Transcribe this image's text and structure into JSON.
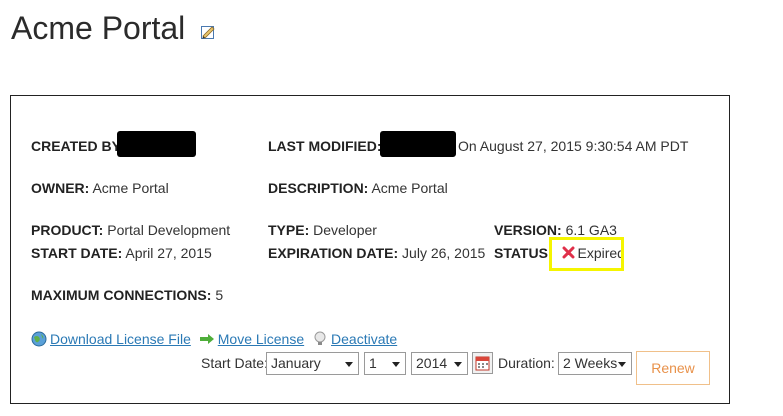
{
  "page": {
    "title": "Acme Portal"
  },
  "details": {
    "created_by_label": "CREATED BY:",
    "last_modified_label": "LAST MODIFIED:",
    "last_modified_value": "On August 27, 2015 9:30:54 AM PDT",
    "owner_label": "OWNER:",
    "owner_value": "Acme Portal",
    "description_label": "DESCRIPTION:",
    "description_value": "Acme Portal",
    "product_label": "PRODUCT:",
    "product_value": "Portal Development",
    "type_label": "TYPE:",
    "type_value": "Developer",
    "version_label": "VERSION:",
    "version_value": "6.1 GA3",
    "start_date_label": "START DATE:",
    "start_date_value": "April 27, 2015",
    "expiration_date_label": "EXPIRATION DATE:",
    "expiration_date_value": "July 26, 2015",
    "status_label": "STATUS:",
    "status_value": "Expired",
    "max_connections_label": "MAXIMUM CONNECTIONS:",
    "max_connections_value": "5"
  },
  "actions": {
    "download": "Download License File",
    "move": "Move License",
    "deactivate": "Deactivate"
  },
  "renew_form": {
    "start_date_label": "Start Date:",
    "month": "January",
    "day": "1",
    "year": "2014",
    "duration_label": "Duration:",
    "duration": "2 Weeks",
    "renew_button": "Renew"
  },
  "icons": {
    "edit": "edit-icon",
    "status": "x-icon",
    "download": "globe-icon",
    "move": "arrow-right-icon",
    "deactivate": "lightbulb-icon",
    "calendar": "calendar-icon"
  },
  "colors": {
    "link": "#2a79b5",
    "renew_text": "#e8914a",
    "highlight": "#f5f500",
    "status_x": "#e0304a"
  }
}
